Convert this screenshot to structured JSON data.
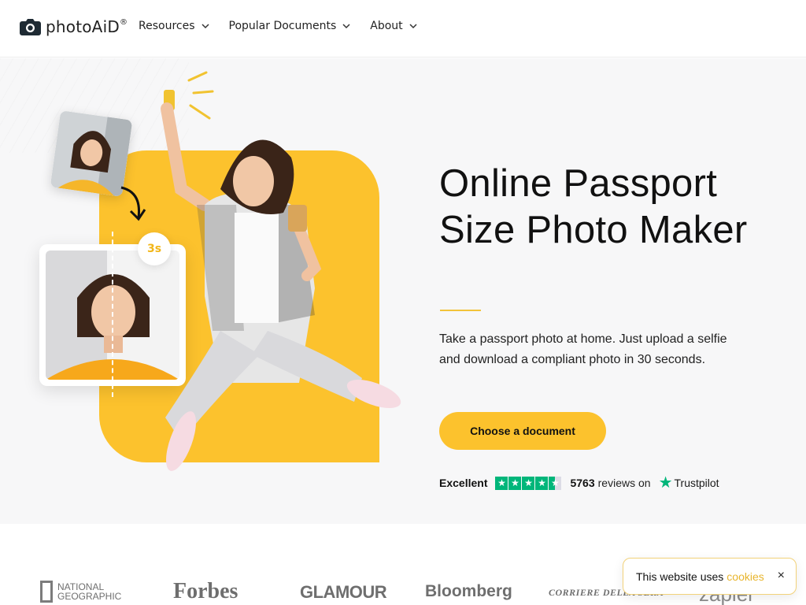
{
  "brand": {
    "name": "photoAiD",
    "registered": "®"
  },
  "nav": {
    "items": [
      {
        "label": "Resources"
      },
      {
        "label": "Popular Documents"
      },
      {
        "label": "About"
      }
    ]
  },
  "hero": {
    "title": "Online Passport Size Photo Maker",
    "description": "Take a passport photo at home. Just upload a selfie and download a compliant photo in 30 seconds.",
    "cta_label": "Choose a document",
    "badge_time": "3s"
  },
  "rating": {
    "label": "Excellent",
    "stars": 4.5,
    "reviews_count": "5763",
    "reviews_text": "reviews on",
    "provider": "Trustpilot",
    "star_color": "#00b67a"
  },
  "press": {
    "logos": [
      {
        "name": "NATIONAL GEOGRAPHIC"
      },
      {
        "name": "Forbes"
      },
      {
        "name": "GLAMOUR"
      },
      {
        "name": "Bloomberg"
      },
      {
        "name": "CORRIERE DELLA SERA"
      },
      {
        "name": "zapier"
      }
    ]
  },
  "cookie": {
    "text": "This website uses",
    "link": "cookies",
    "close_icon": "×"
  },
  "colors": {
    "accent": "#fcc22d",
    "trustpilot": "#00b67a"
  }
}
